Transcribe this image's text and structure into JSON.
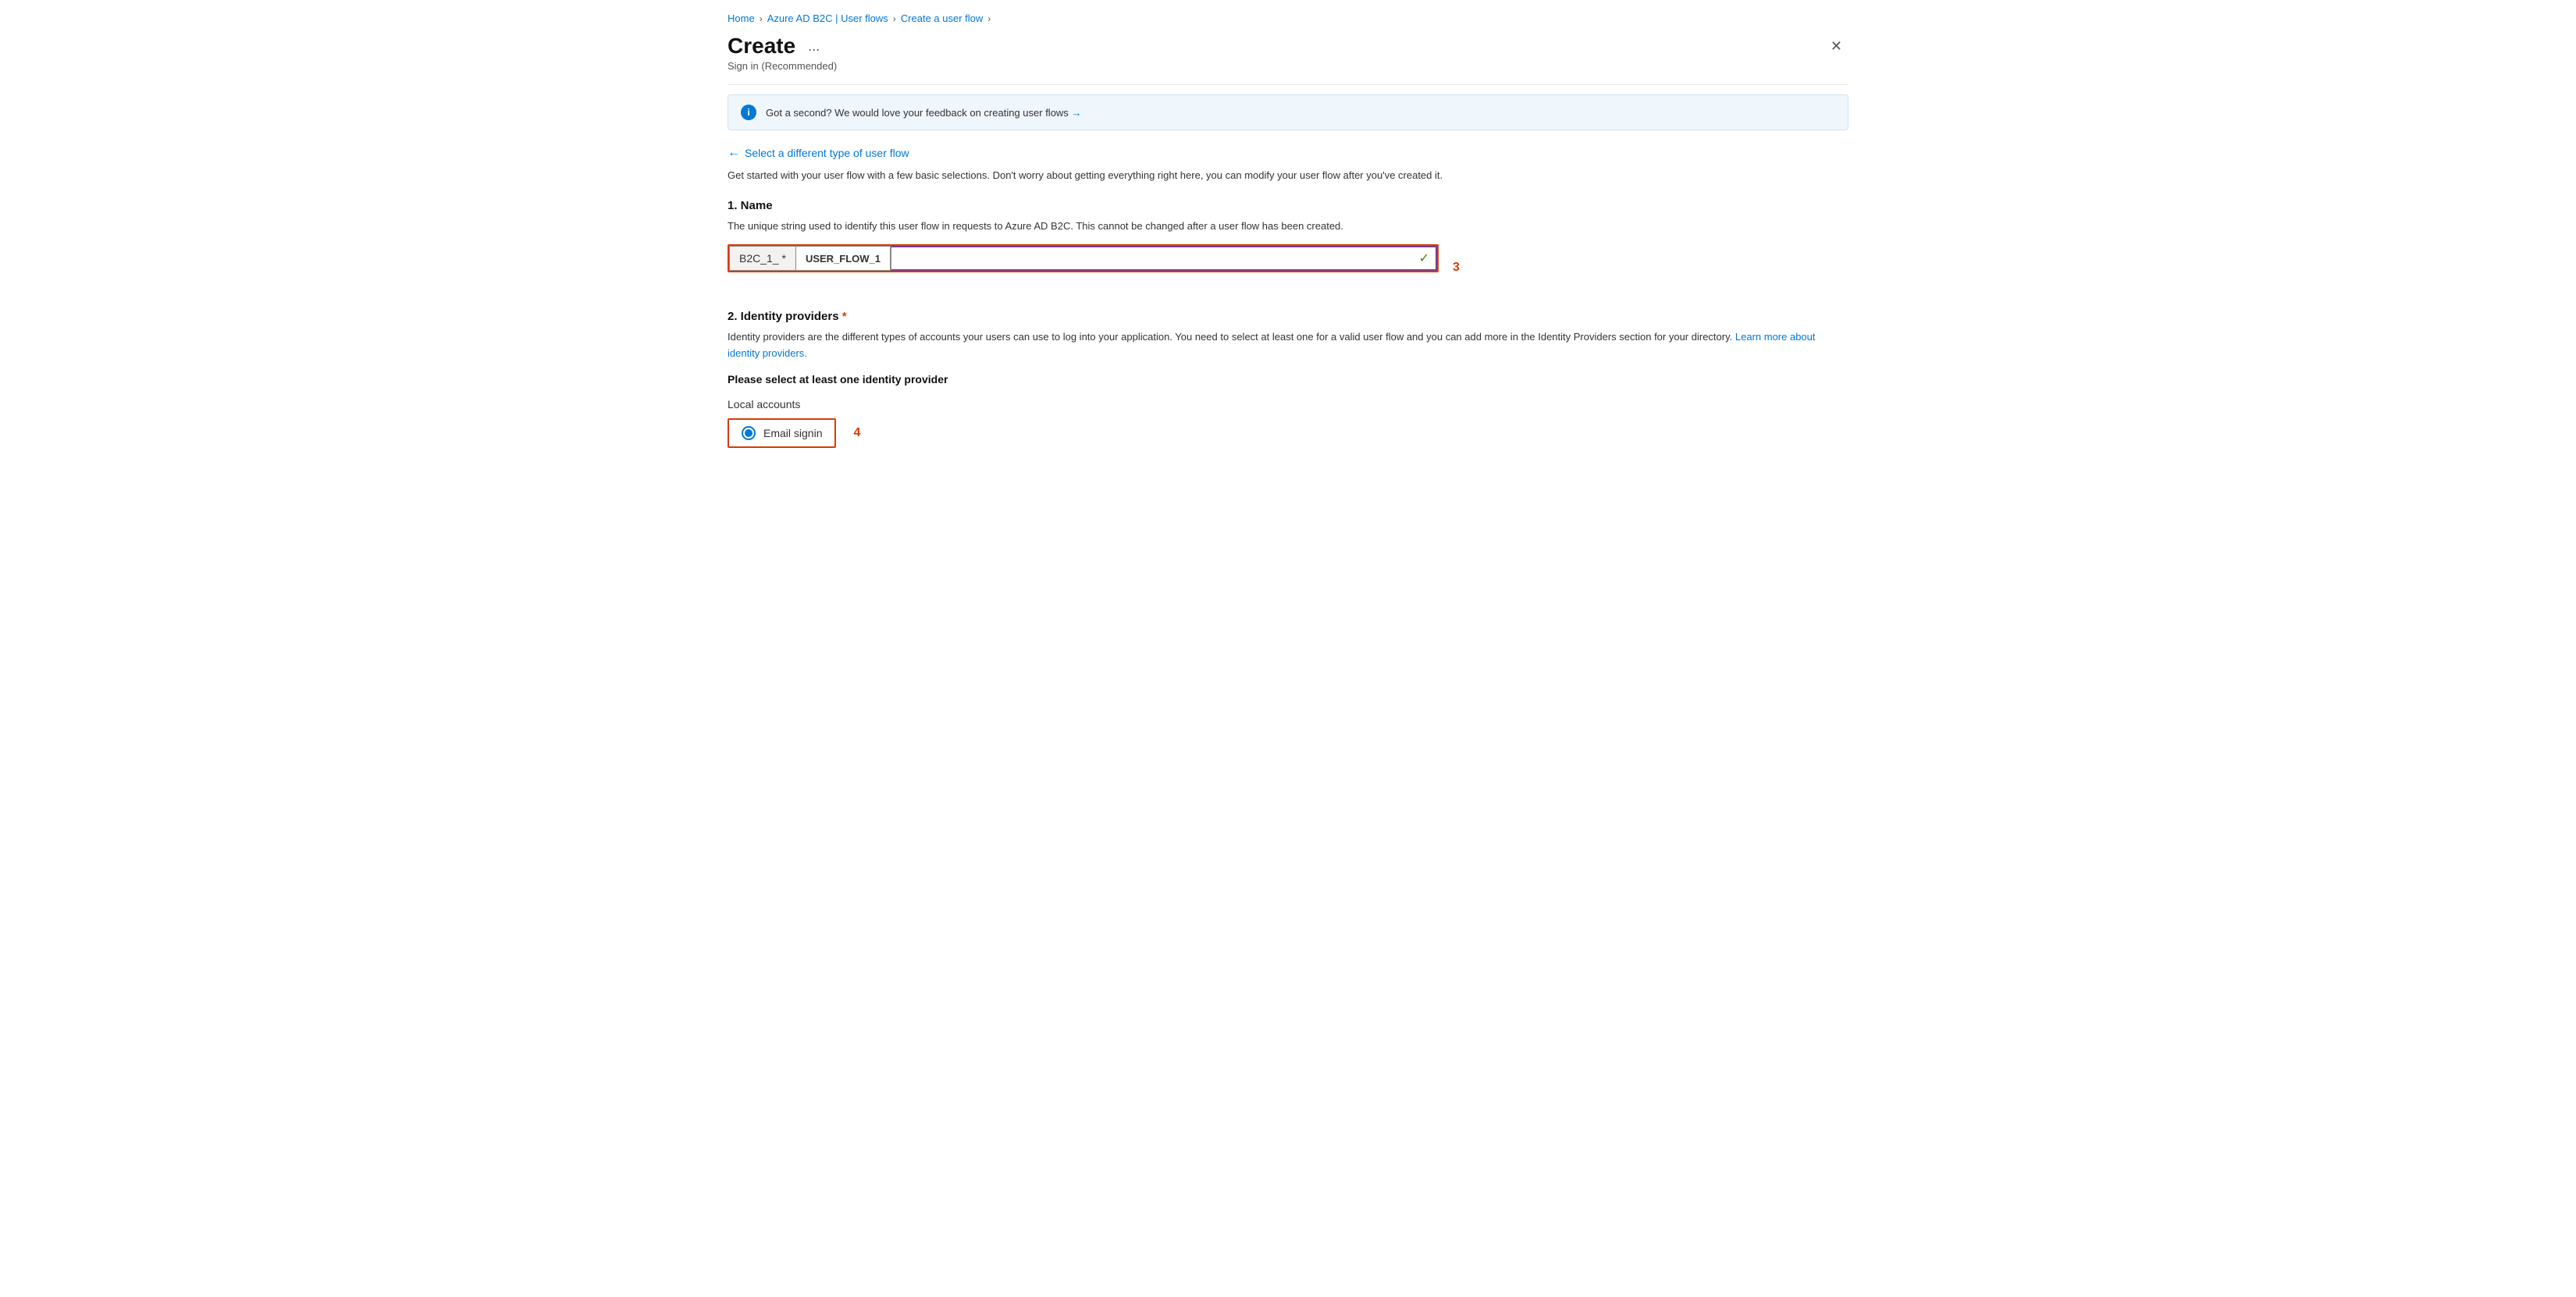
{
  "breadcrumb": {
    "items": [
      {
        "label": "Home",
        "href": "#"
      },
      {
        "label": "Azure AD B2C | User flows",
        "href": "#"
      },
      {
        "label": "Create a user flow",
        "href": "#"
      }
    ],
    "separators": [
      ">",
      ">",
      ">"
    ]
  },
  "header": {
    "title": "Create",
    "ellipsis": "...",
    "subtitle": "Sign in (Recommended)",
    "close_label": "✕"
  },
  "info_banner": {
    "icon": "i",
    "text": "Got a second? We would love your feedback on creating user flows",
    "arrow": "→"
  },
  "back_link": {
    "arrow": "←",
    "label": "Select a different type of user flow"
  },
  "description": "Get started with your user flow with a few basic selections. Don't worry about getting everything right here, you can modify your user flow after you've created it.",
  "section1": {
    "title": "1. Name",
    "description": "The unique string used to identify this user flow in requests to Azure AD B2C. This cannot be changed after a user flow has been created.",
    "prefix_label": "B2C_1_ *",
    "prefix_inner": "USER_FLOW_1",
    "input_value": "",
    "annotation": "3",
    "checkmark": "✓"
  },
  "section2": {
    "title": "2. Identity providers",
    "required_star": "*",
    "description1": "Identity providers are the different types of accounts your users can use to log into your application. You need to select at least one for a valid user flow and you can add more in the Identity Providers section for your directory.",
    "learn_more_link": "Learn more about identity providers.",
    "please_select": "Please select at least one identity provider",
    "local_accounts_label": "Local accounts",
    "radio_option": {
      "label": "Email signin",
      "selected": true
    },
    "annotation": "4"
  }
}
